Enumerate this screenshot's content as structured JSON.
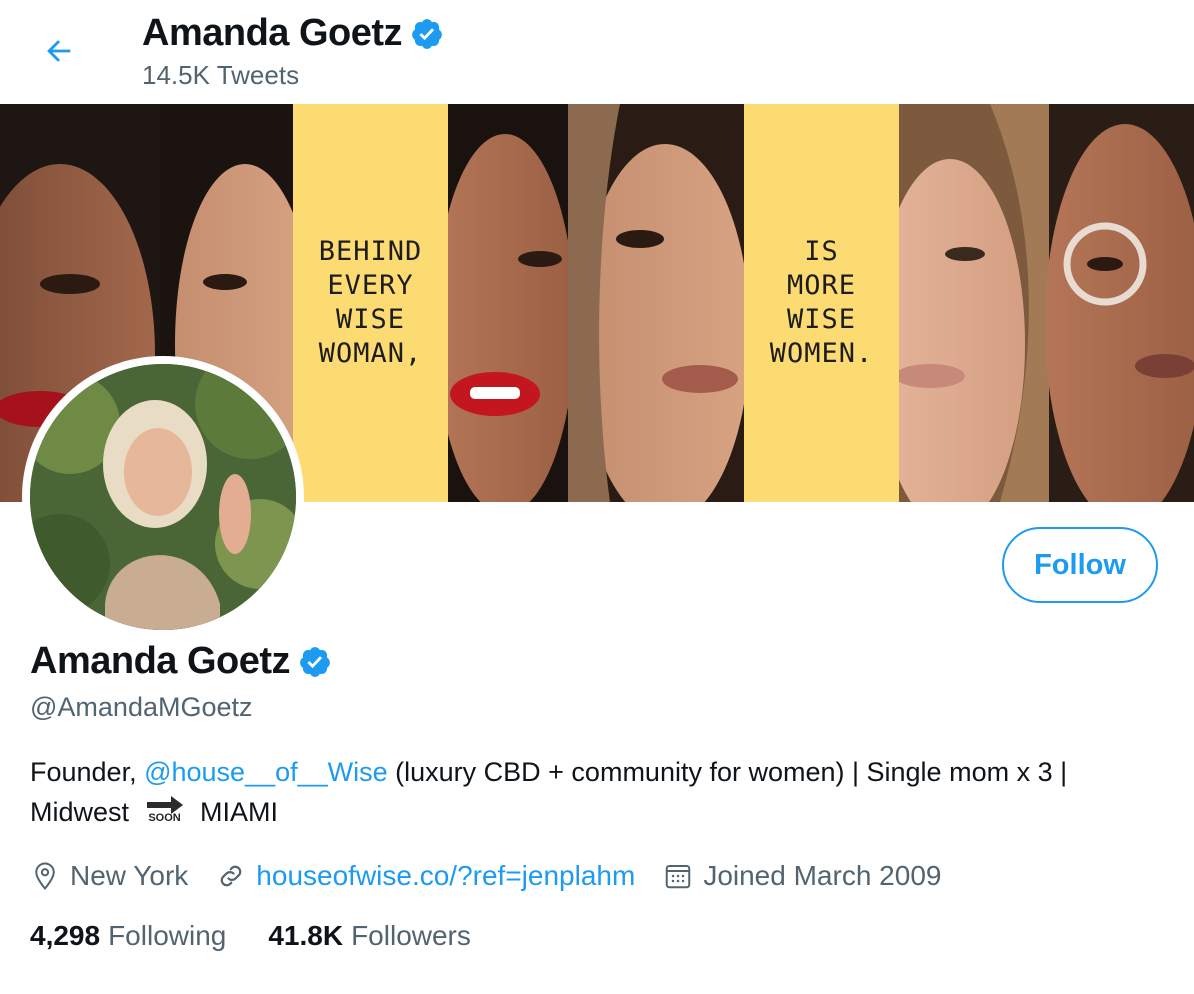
{
  "header": {
    "name": "Amanda Goetz",
    "tweet_count": "14.5K Tweets"
  },
  "banner": {
    "panel_left_text": "BEHIND\nEVERY\nWISE\nWOMAN,",
    "panel_right_text": "IS\nMORE\nWISE\nWOMEN.",
    "panel_color": "#fddb73"
  },
  "profile": {
    "name": "Amanda Goetz",
    "handle": "@AmandaMGoetz",
    "follow_label": "Follow",
    "bio": {
      "prefix": "Founder, ",
      "mention": "@house__of__Wise",
      "middle": " (luxury CBD + community for women) | Single mom x 3 | Midwest ",
      "emoji_label": "SOON",
      "suffix": " MIAMI"
    },
    "location": "New York",
    "website": "houseofwise.co/?ref=jenplahm",
    "joined": "Joined March 2009"
  },
  "stats": {
    "following_count": "4,298",
    "following_label": "Following",
    "followers_count": "41.8K",
    "followers_label": "Followers"
  },
  "colors": {
    "accent": "#1d9bf0",
    "muted_text": "#536471",
    "primary_text": "#0f1419"
  },
  "icons": {
    "back": "arrow-left-icon",
    "verified": "verified-badge-icon",
    "location": "location-pin-icon",
    "link": "link-icon",
    "calendar": "calendar-icon",
    "soon": "soon-arrow-icon"
  }
}
